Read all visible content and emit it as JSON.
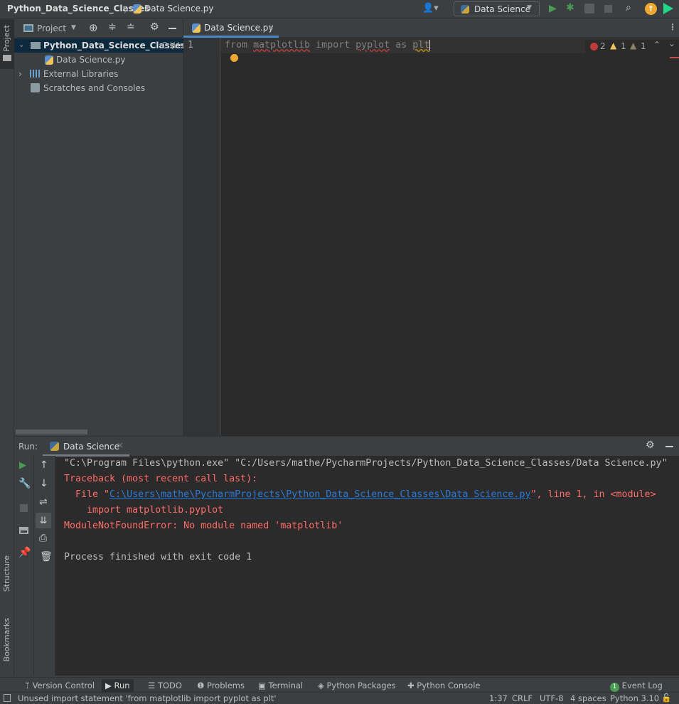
{
  "titlebar": {
    "project": "Python_Data_Science_Classes",
    "file": "Data Science.py",
    "run_config": "Data Science"
  },
  "left_stripe": {
    "project": "Project",
    "structure": "Structure",
    "bookmarks": "Bookmarks"
  },
  "project_panel": {
    "title": "Project",
    "items": [
      {
        "label": "Python_Data_Science_Classes",
        "path": "C:\\Users"
      },
      {
        "label": "Data Science.py"
      },
      {
        "label": "External Libraries"
      },
      {
        "label": "Scratches and Consoles"
      }
    ]
  },
  "editor": {
    "tab": "Data Science.py",
    "line_number": "1",
    "code": "from matplotlib import pyplot as plt",
    "code_parts": [
      "from ",
      "matplotlib",
      " import ",
      "pyplot",
      " as ",
      "plt"
    ],
    "inspections": {
      "errors": "2",
      "warnings": "1",
      "weak_warnings": "1"
    }
  },
  "run": {
    "label": "Run:",
    "tab": "Data Science",
    "output": {
      "cmd": "\"C:\\Program Files\\python.exe\" \"C:/Users/mathe/PycharmProjects/Python_Data_Science_Classes/Data Science.py\"",
      "traceback": "Traceback (most recent call last):",
      "file_prefix": "  File \"",
      "file_link": "C:\\Users\\mathe\\PycharmProjects\\Python_Data_Science_Classes\\Data Science.py",
      "file_suffix": "\", line 1, in <module>",
      "import_line": "    import matplotlib.pyplot",
      "error": "ModuleNotFoundError: No module named 'matplotlib'",
      "exit": "Process finished with exit code 1"
    }
  },
  "toolwindows": [
    "Version Control",
    "Run",
    "TODO",
    "Problems",
    "Terminal",
    "Python Packages",
    "Python Console"
  ],
  "event_log": {
    "label": "Event Log",
    "count": "1"
  },
  "status": {
    "message": "Unused import statement 'from matplotlib import pyplot as plt'",
    "position": "1:37",
    "line_sep": "CRLF",
    "encoding": "UTF-8",
    "indent": "4 spaces",
    "interpreter": "Python 3.10"
  },
  "colors": {
    "error": "#ff6b68",
    "link": "#287bde",
    "run_green": "#499c54",
    "warning": "#f2c55c"
  }
}
